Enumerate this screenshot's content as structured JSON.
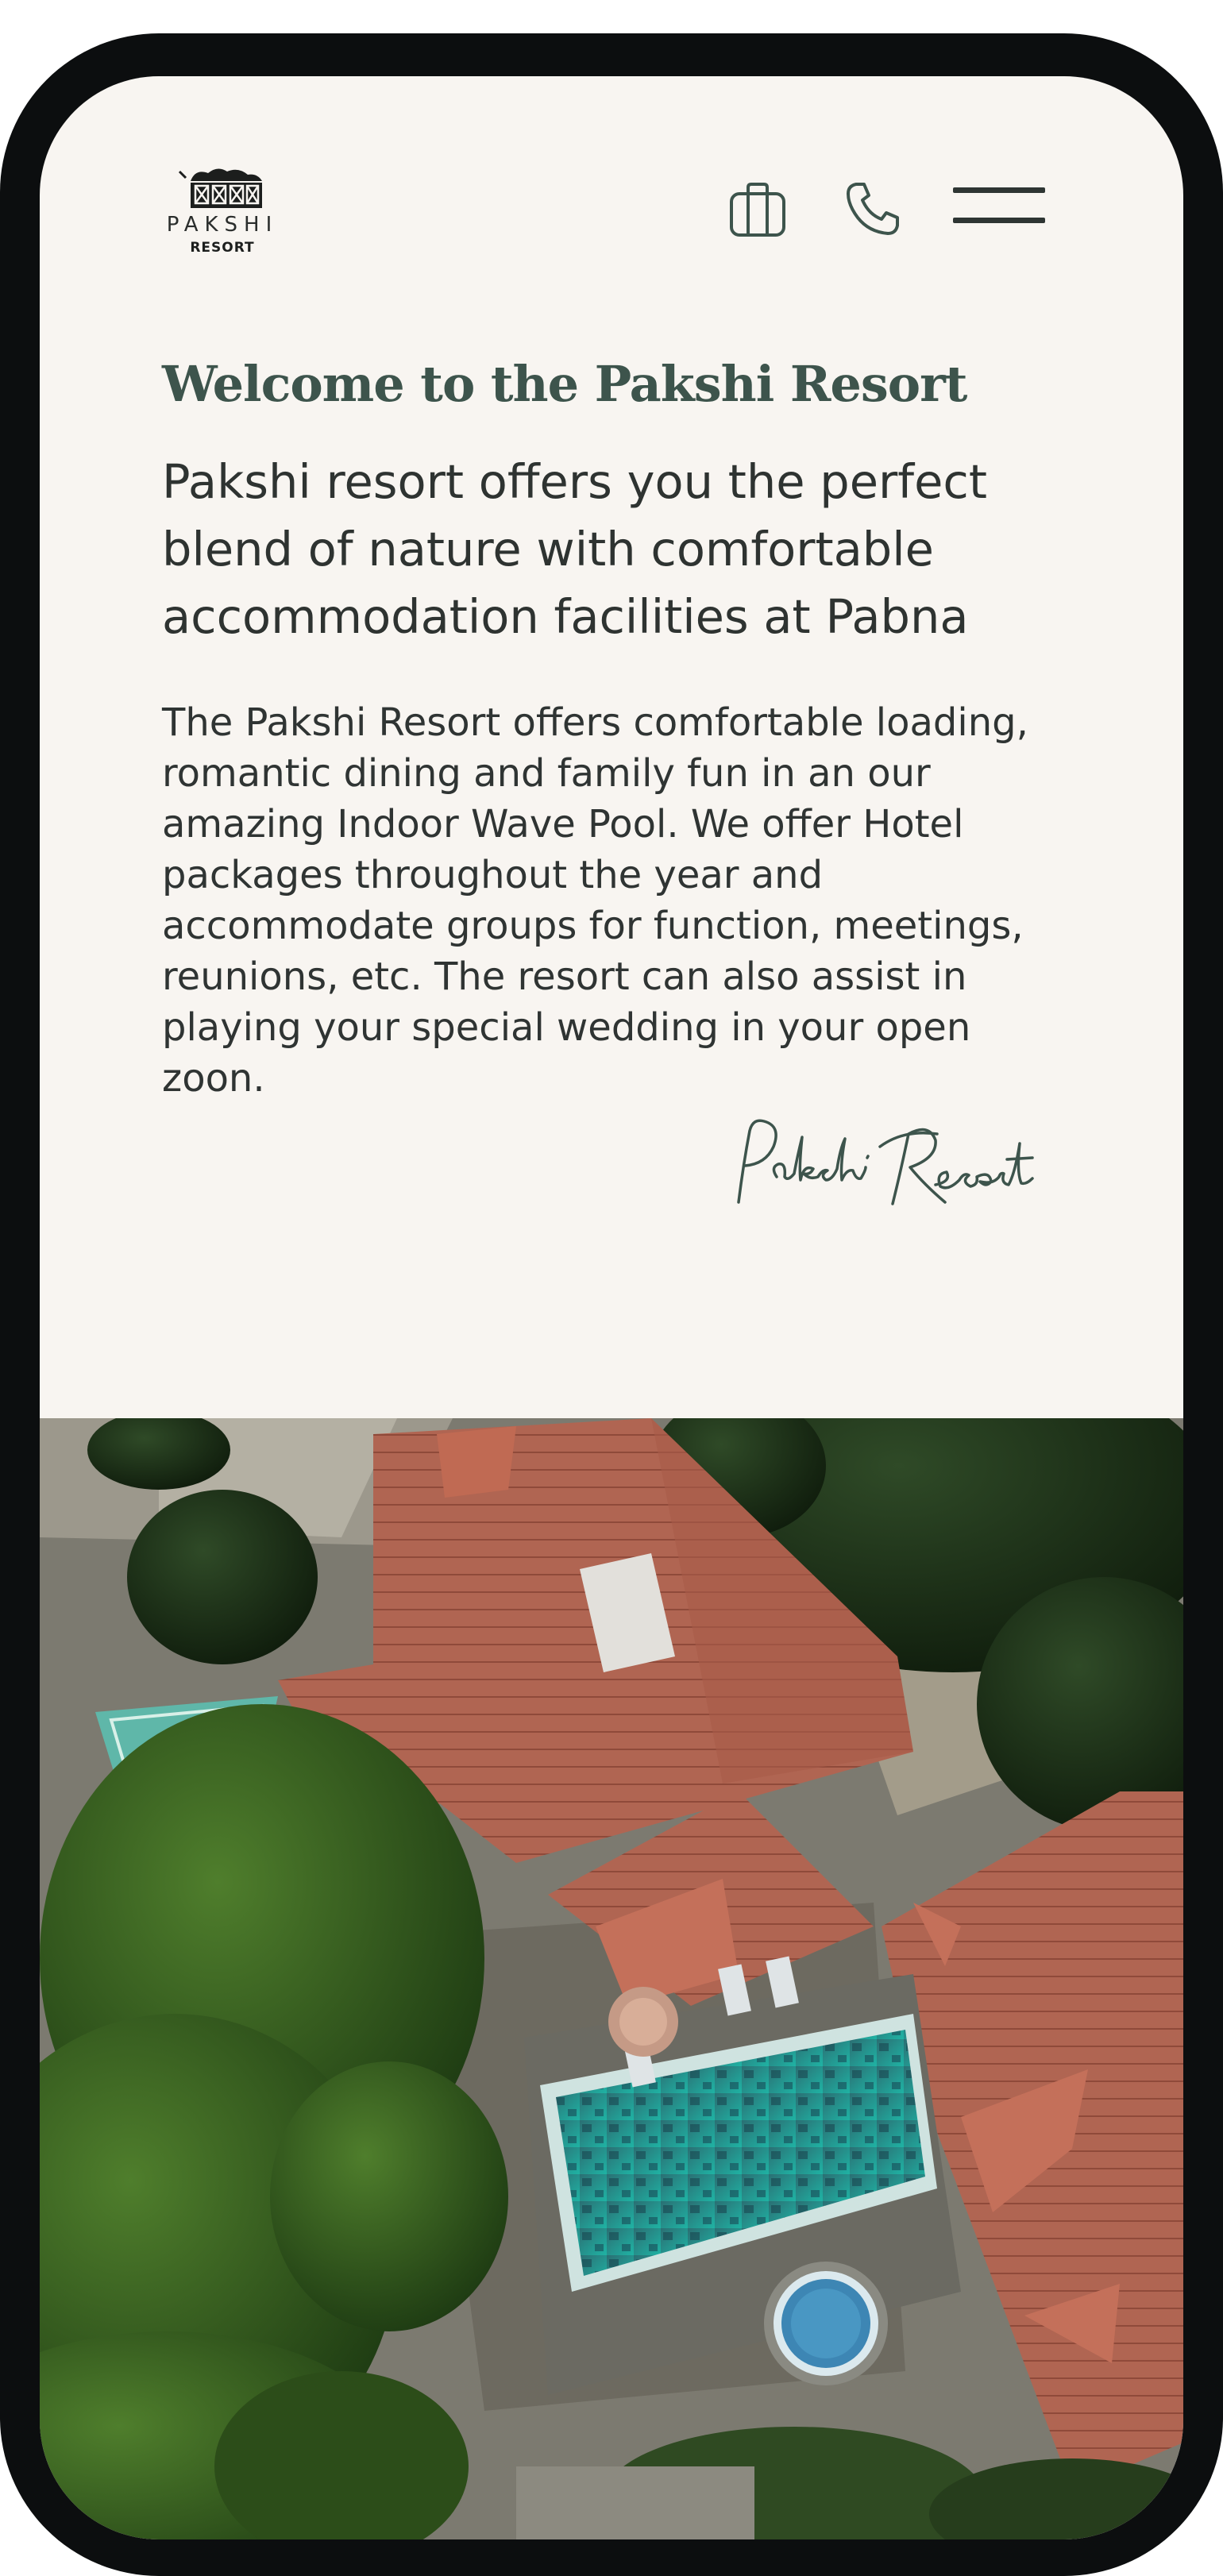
{
  "header": {
    "logo": {
      "wordmark": "PAKSHI",
      "subtitle": "RESORT",
      "icon": "resort-building-logo"
    },
    "actions": [
      {
        "icon": "briefcase-icon"
      },
      {
        "icon": "phone-icon"
      },
      {
        "icon": "hamburger-menu-icon"
      }
    ]
  },
  "hero": {
    "title": "Welcome to the Pakshi Resort",
    "lead": "Pakshi resort offers you the perfect blend of nature with comfortable accommodation facilities at Pabna",
    "body": "The Pakshi Resort offers comfortable loading, romantic dining and family fun in an our amazing Indoor Wave Pool. We offer Hotel packages throughout the year and accommodate groups for function, meetings, reunions, etc. The resort can also assist in playing your special wedding in your open zoon.",
    "signature": "Pakshi Resort"
  },
  "colors": {
    "background": "#f8f5f1",
    "accent": "#3d544c",
    "text": "#2e3331",
    "frame": "#0c0e0f"
  }
}
